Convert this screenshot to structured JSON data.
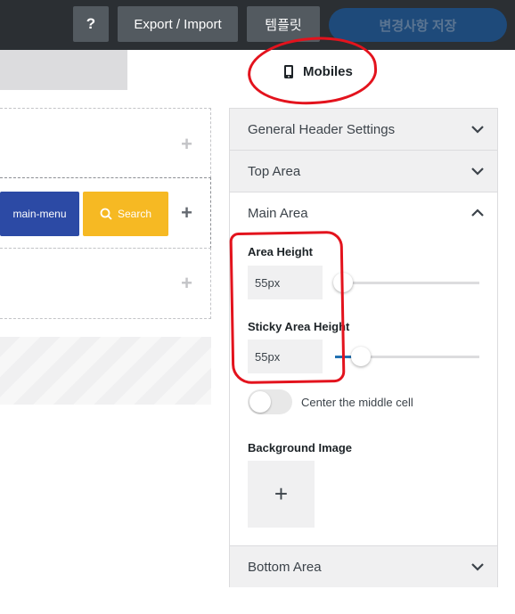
{
  "toolbar": {
    "help_label": "?",
    "export_label": "Export / Import",
    "template_label": "템플릿",
    "save_label": "변경사항 저장"
  },
  "device": {
    "label": "Mobiles",
    "icon": "phone-icon"
  },
  "builder": {
    "menu_label": "main-menu",
    "search_label": "Search",
    "add_symbol": "+"
  },
  "sidebar": {
    "sections": [
      {
        "label": "General Header Settings",
        "expanded": false
      },
      {
        "label": "Top Area",
        "expanded": false
      },
      {
        "label": "Main Area",
        "expanded": true
      },
      {
        "label": "Bottom Area",
        "expanded": false
      }
    ],
    "main_area": {
      "area_height": {
        "label": "Area Height",
        "value": "55px"
      },
      "sticky_height": {
        "label": "Sticky Area Height",
        "value": "55px"
      },
      "center_toggle": {
        "label": "Center the middle cell",
        "on": false
      },
      "background": {
        "label": "Background Image",
        "add_symbol": "+"
      }
    }
  },
  "colors": {
    "topbar": "#2b2f33",
    "toolbar_button": "#535a60",
    "save_button": "#1e4a7a",
    "menu_button": "#2c4aa5",
    "search_button": "#f6b923",
    "annotation": "#e3131d",
    "accent": "#2271b1"
  }
}
